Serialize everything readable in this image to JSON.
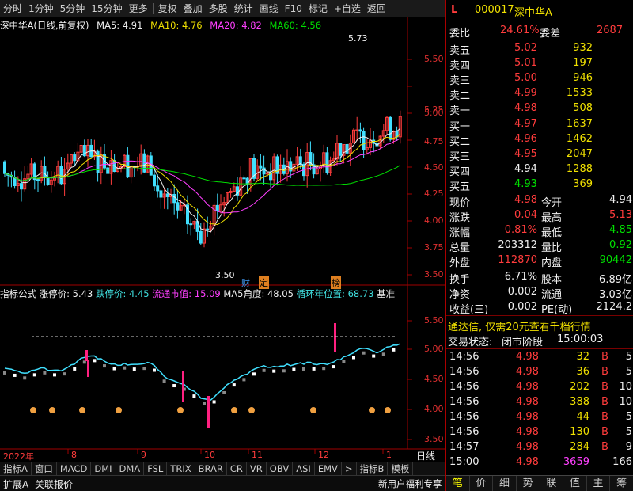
{
  "toolbar": {
    "items": [
      "分时",
      "1分钟",
      "5分钟",
      "15分钟",
      "更多",
      "复权",
      "叠加",
      "多股",
      "统计",
      "画线",
      "F10",
      "标记",
      "+自选",
      "返回"
    ]
  },
  "chart_header": {
    "name": "深中华A(日线,前复权)",
    "ma5": "MA5: 4.91",
    "ma10": "MA10: 4.76",
    "ma20": "MA20: 4.82",
    "ma60": "MA60: 4.56"
  },
  "main_axis": [
    "5.50",
    "5.25",
    "5.00",
    "4.75",
    "4.50",
    "4.25",
    "4.00",
    "3.75",
    "3.50"
  ],
  "main_annotations": {
    "high": "5.73",
    "low": "3.50",
    "tag1": "财",
    "tag2": "定",
    "tag3": "榜"
  },
  "indicator_header": {
    "name": "指标公式",
    "limit_up": "涨停价: 5.43",
    "limit_down": "跌停价: 4.45",
    "float_mv": "流通市值: 15.09",
    "ma5_angle": "MA5角度: 48.05",
    "cycle": "循环年位置: 68.73",
    "base": "基准"
  },
  "ind_axis": [
    "5.50",
    "5.00",
    "4.50",
    "4.00",
    "3.50"
  ],
  "time_axis": {
    "year": "2022年",
    "m8": "8",
    "m9": "9",
    "m10": "10",
    "m11": "11",
    "m12": "12",
    "m1": "1",
    "period": "日线"
  },
  "tabs": [
    "指标A",
    "窗口",
    "MACD",
    "DMI",
    "DMA",
    "FSL",
    "TRIX",
    "BRAR",
    "CR",
    "VR",
    "OBV",
    "ASI",
    "EMV",
    ">",
    "指标B",
    "模板"
  ],
  "status": {
    "expand": "扩展A",
    "related": "关联报价",
    "promo": "新用户福利专享"
  },
  "quote": {
    "flag": "L",
    "code": "000017",
    "name": "深中华A",
    "weibi_label": "委比",
    "weibi": "24.61%",
    "weicha_label": "委差",
    "weicha": "2687",
    "asks": [
      {
        "label": "卖五",
        "price": "5.02",
        "vol": "932"
      },
      {
        "label": "卖四",
        "price": "5.01",
        "vol": "197"
      },
      {
        "label": "卖三",
        "price": "5.00",
        "vol": "946"
      },
      {
        "label": "卖二",
        "price": "4.99",
        "vol": "1533"
      },
      {
        "label": "卖一",
        "price": "4.98",
        "vol": "508"
      }
    ],
    "bids": [
      {
        "label": "买一",
        "price": "4.97",
        "vol": "1637"
      },
      {
        "label": "买二",
        "price": "4.96",
        "vol": "1462"
      },
      {
        "label": "买三",
        "price": "4.95",
        "vol": "2047"
      },
      {
        "label": "买四",
        "price": "4.94",
        "vol": "1288"
      },
      {
        "label": "买五",
        "price": "4.93",
        "vol": "369"
      }
    ],
    "stats": [
      {
        "l1": "现价",
        "v1": "4.98",
        "l2": "今开",
        "v2": "4.94"
      },
      {
        "l1": "涨跌",
        "v1": "0.04",
        "l2": "最高",
        "v2": "5.13"
      },
      {
        "l1": "涨幅",
        "v1": "0.81%",
        "l2": "最低",
        "v2": "4.85"
      },
      {
        "l1": "总量",
        "v1": "203312",
        "l2": "量比",
        "v2": "0.92"
      },
      {
        "l1": "外盘",
        "v1": "112870",
        "l2": "内盘",
        "v2": "90442"
      }
    ],
    "stats2": [
      {
        "l1": "换手",
        "v1": "6.71%",
        "l2": "股本",
        "v2": "6.89亿"
      },
      {
        "l1": "净资",
        "v1": "0.002",
        "l2": "流通",
        "v2": "3.03亿"
      },
      {
        "l1": "收益(三)",
        "v1": "0.002",
        "l2": "PE(动)",
        "v2": "2124.2"
      }
    ],
    "ad": "通达信, 仅需20元查看千档行情",
    "trade_state_label": "交易状态:",
    "trade_state": "闭市阶段",
    "trade_time": "15:00:03",
    "ticks": [
      {
        "t": "14:56",
        "p": "4.98",
        "v": "32",
        "d": "B",
        "n": "5"
      },
      {
        "t": "14:56",
        "p": "4.98",
        "v": "36",
        "d": "B",
        "n": "5"
      },
      {
        "t": "14:56",
        "p": "4.98",
        "v": "202",
        "d": "B",
        "n": "10"
      },
      {
        "t": "14:56",
        "p": "4.98",
        "v": "388",
        "d": "B",
        "n": "10"
      },
      {
        "t": "14:56",
        "p": "4.98",
        "v": "44",
        "d": "B",
        "n": "5"
      },
      {
        "t": "14:56",
        "p": "4.98",
        "v": "130",
        "d": "B",
        "n": "5"
      },
      {
        "t": "14:57",
        "p": "4.98",
        "v": "284",
        "d": "B",
        "n": "9"
      },
      {
        "t": "15:00",
        "p": "4.98",
        "v": "3659",
        "d": "",
        "n": "166"
      }
    ],
    "bottom_tabs": [
      "笔",
      "价",
      "细",
      "势",
      "联",
      "值",
      "主",
      "筹"
    ]
  }
}
